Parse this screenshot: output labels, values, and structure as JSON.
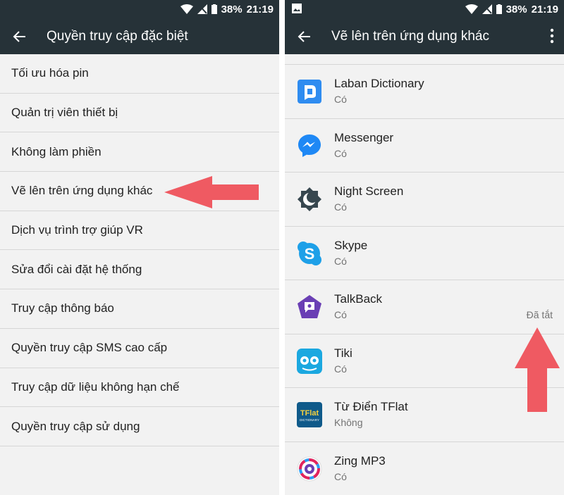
{
  "status": {
    "battery": "38%",
    "time": "21:19"
  },
  "left_screen": {
    "title": "Quyền truy cập đặc biệt",
    "items": [
      {
        "label": "Tối ưu hóa pin"
      },
      {
        "label": "Quản trị viên thiết bị"
      },
      {
        "label": "Không làm phiền"
      },
      {
        "label": "Vẽ lên trên ứng dụng khác"
      },
      {
        "label": "Dịch vụ trình trợ giúp VR"
      },
      {
        "label": "Sửa đổi cài đặt hệ thống"
      },
      {
        "label": "Truy cập thông báo"
      },
      {
        "label": "Quyền truy cập SMS cao cấp"
      },
      {
        "label": "Truy cập dữ liệu không hạn chế"
      },
      {
        "label": "Quyền truy cập sử dụng"
      }
    ]
  },
  "right_screen": {
    "title": "Vẽ lên trên ứng dụng khác",
    "apps": [
      {
        "name": "Laban Dictionary",
        "status": "Có",
        "icon": "laban-dictionary-icon"
      },
      {
        "name": "Messenger",
        "status": "Có",
        "icon": "messenger-icon"
      },
      {
        "name": "Night Screen",
        "status": "Có",
        "icon": "night-screen-icon"
      },
      {
        "name": "Skype",
        "status": "Có",
        "icon": "skype-icon"
      },
      {
        "name": "TalkBack",
        "status": "Có",
        "note": "Đã tắt",
        "icon": "talkback-icon"
      },
      {
        "name": "Tiki",
        "status": "Có",
        "icon": "tiki-icon"
      },
      {
        "name": "Từ Điển TFlat",
        "status": "Không",
        "icon": "tflat-icon",
        "icon_text": "TFlat",
        "icon_subtext": "DICTIONARY"
      },
      {
        "name": "Zing MP3",
        "status": "Có",
        "icon": "zing-mp3-icon"
      }
    ]
  },
  "colors": {
    "toolbar": "#263238",
    "background": "#f2f2f2",
    "annotation_arrow": "#ef5a62"
  }
}
